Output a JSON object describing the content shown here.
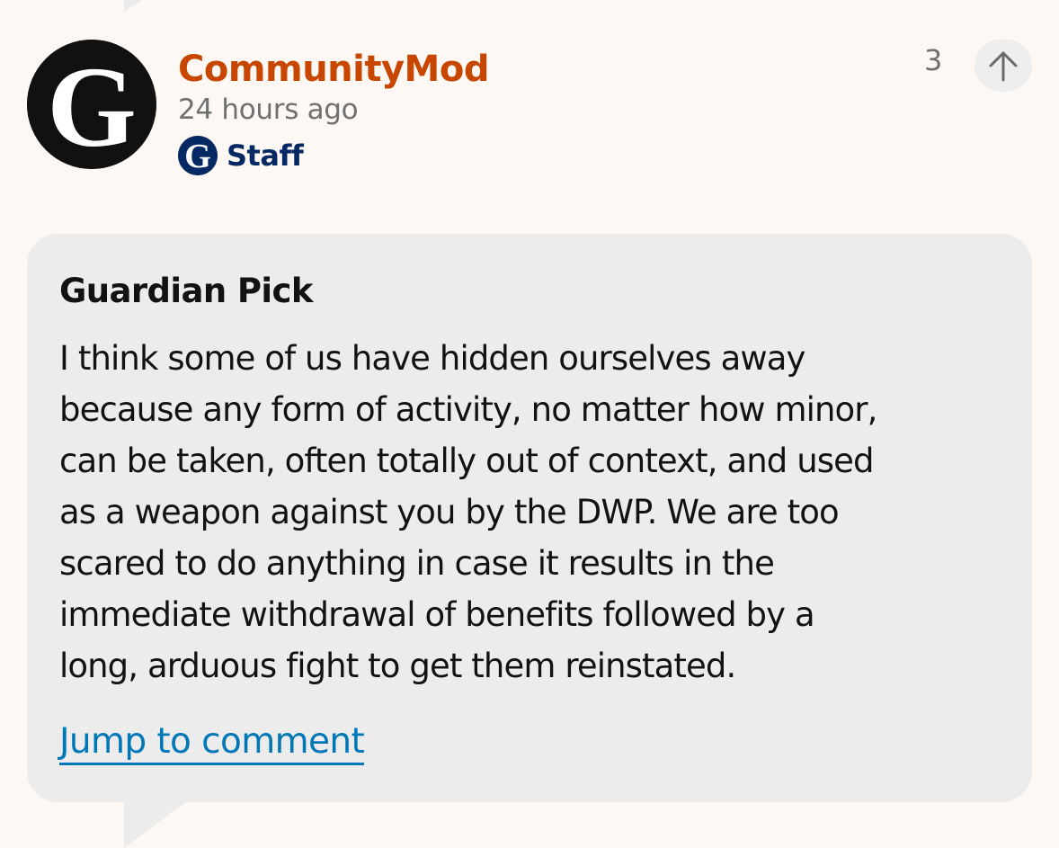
{
  "comment": {
    "username": "CommunityMod",
    "timestamp": "24 hours ago",
    "badge": "Staff",
    "recommend_count": "3",
    "avatar_icon": "guardian-g-logo",
    "recommend_icon": "arrow-up-icon"
  },
  "pick": {
    "heading": "Guardian Pick",
    "body_lines": [
      "I think some of us have hidden ourselves away",
      "because any form of activity, no matter how minor,",
      "can be taken, often totally out of context, and used",
      "as a weapon against you by the DWP. We are too",
      "scared to do anything in case it results in the",
      "immediate withdrawal of benefits followed by a",
      "long, arduous fight to get them reinstated."
    ],
    "link_label": "Jump to comment"
  },
  "colors": {
    "background": "#fdf8f4",
    "username": "#c74600",
    "staff": "#052962",
    "link": "#0077b6",
    "card": "#ececec"
  }
}
